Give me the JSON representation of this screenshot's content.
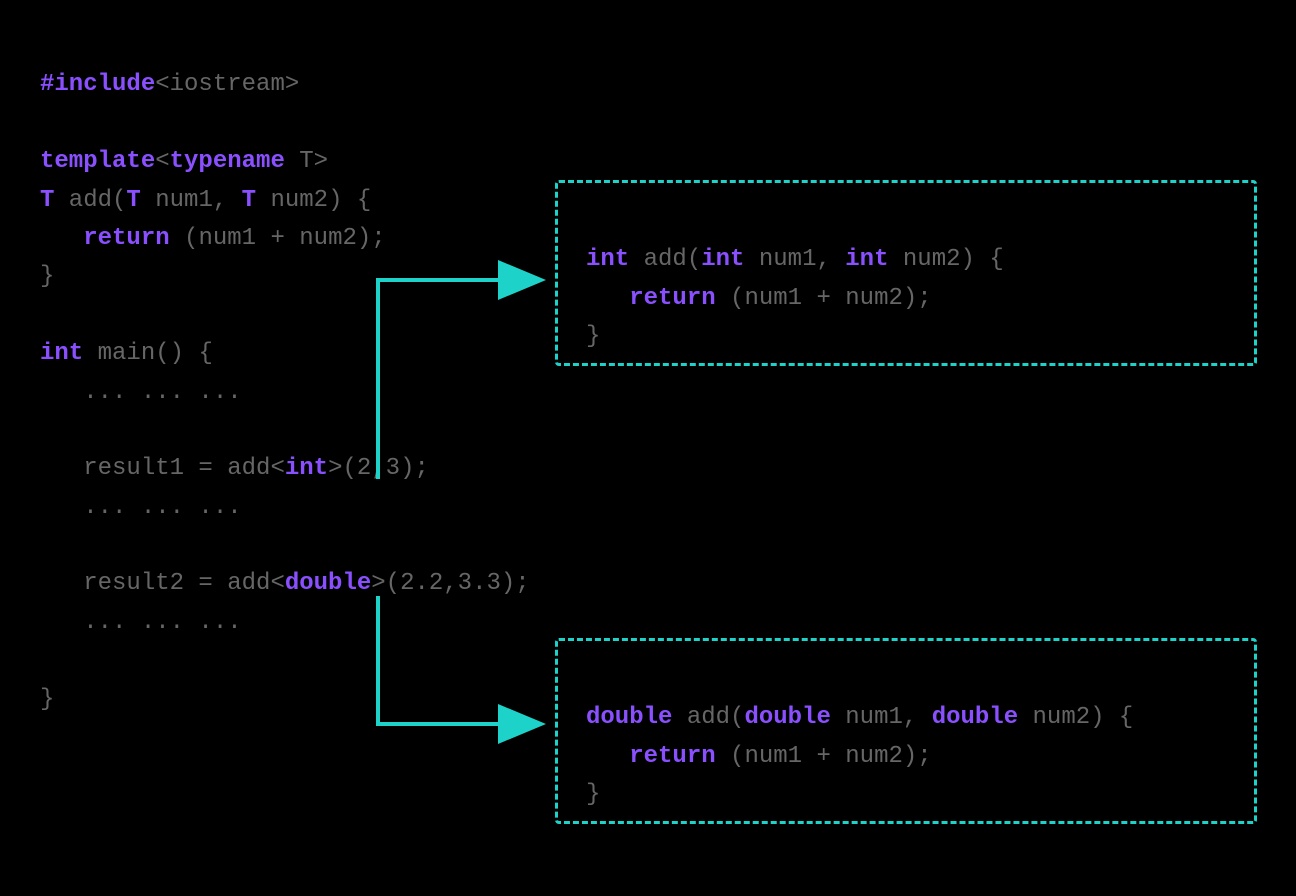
{
  "colors": {
    "keyword": "#8a4fff",
    "default": "#666666",
    "arrow": "#1dd3c9",
    "background": "#000000"
  },
  "main_code": {
    "line1": {
      "include": "#include",
      "header": "<iostream>"
    },
    "line3": {
      "template_kw": "template",
      "lt": "<",
      "typename_kw": "typename",
      "t": " T",
      "gt": ">"
    },
    "line4": {
      "t1": "T",
      "add_open": " add(",
      "t2": "T",
      "num1": " num1, ",
      "t3": "T",
      "num2_close": " num2) {"
    },
    "line5": {
      "indent": "   ",
      "return_kw": "return",
      "expr": " (num1 + num2);"
    },
    "line6": {
      "brace": "}"
    },
    "line8": {
      "int_kw": "int",
      "main_text": " main() {"
    },
    "line9": {
      "dots": "   ... ... ..."
    },
    "line11": {
      "prefix": "   result1 = add<",
      "int_kw": "int",
      "suffix": ">(2,3);"
    },
    "line12": {
      "dots": "   ... ... ..."
    },
    "line14": {
      "prefix": "   result2 = add<",
      "double_kw": "double",
      "suffix": ">(2.2,3.3);"
    },
    "line15": {
      "dots": "   ... ... ..."
    },
    "line17": {
      "brace": "}"
    }
  },
  "callout1": {
    "line1": {
      "int1": "int",
      "add_open": " add(",
      "int2": "int",
      "num1": " num1, ",
      "int3": "int",
      "num2_close": " num2) {"
    },
    "line2": {
      "indent": "   ",
      "return_kw": "return",
      "expr": " (num1 + num2);"
    },
    "line3": {
      "brace": "}"
    }
  },
  "callout2": {
    "line1": {
      "d1": "double",
      "add_open": " add(",
      "d2": "double",
      "num1": " num1, ",
      "d3": "double",
      "num2_close": " num2) {"
    },
    "line2": {
      "indent": "   ",
      "return_kw": "return",
      "expr": " (num1 + num2);"
    },
    "line3": {
      "brace": "}"
    }
  }
}
